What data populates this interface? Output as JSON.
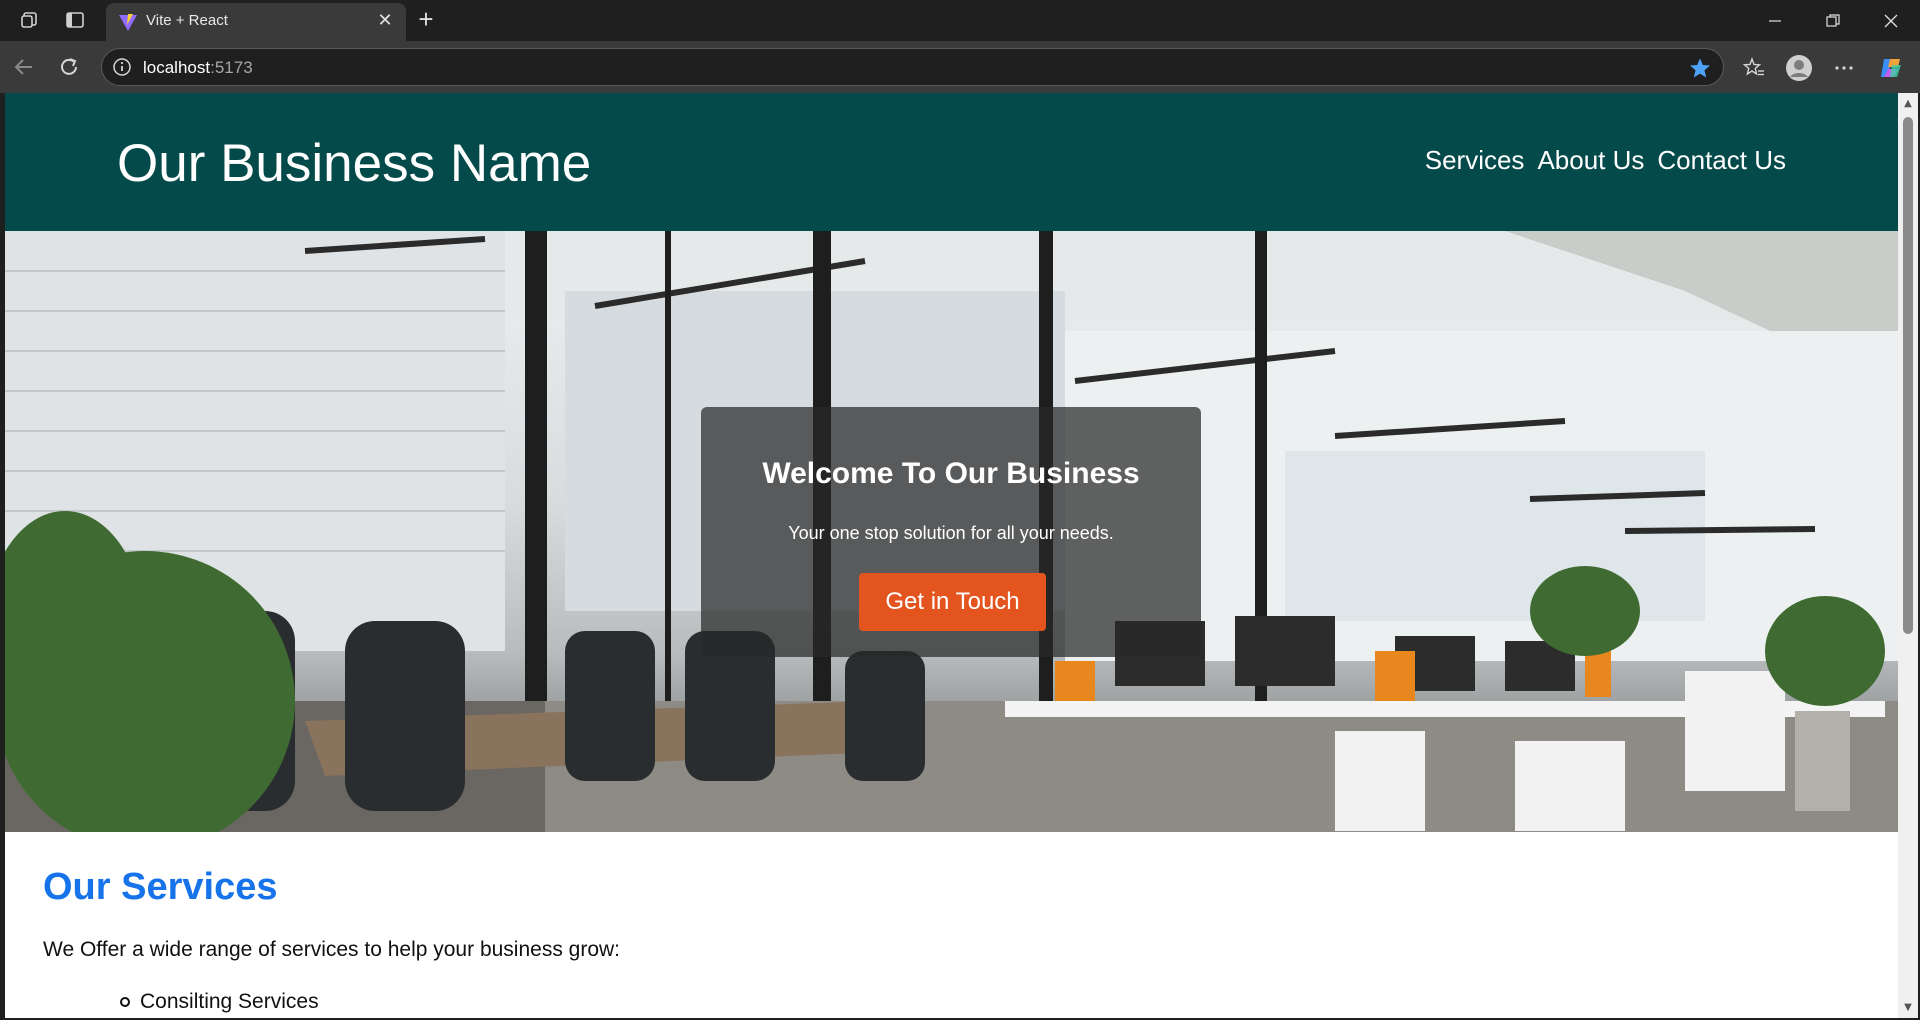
{
  "browser": {
    "tab_title": "Vite + React",
    "url_host": "localhost",
    "url_port": ":5173"
  },
  "site": {
    "brand": "Our Business Name",
    "nav": [
      "Services",
      "About Us",
      "Contact Us"
    ]
  },
  "hero": {
    "title": "Welcome To Our Business",
    "subtitle": "Your one stop solution for all your needs.",
    "button": "Get in Touch"
  },
  "services": {
    "title": "Our Services",
    "description": "We Offer a wide range of services to help your business grow:",
    "items": [
      "Consilting Services"
    ]
  },
  "colors": {
    "header_bg": "#054a4a",
    "accent_button": "#e4541f",
    "services_title": "#1673ea"
  }
}
